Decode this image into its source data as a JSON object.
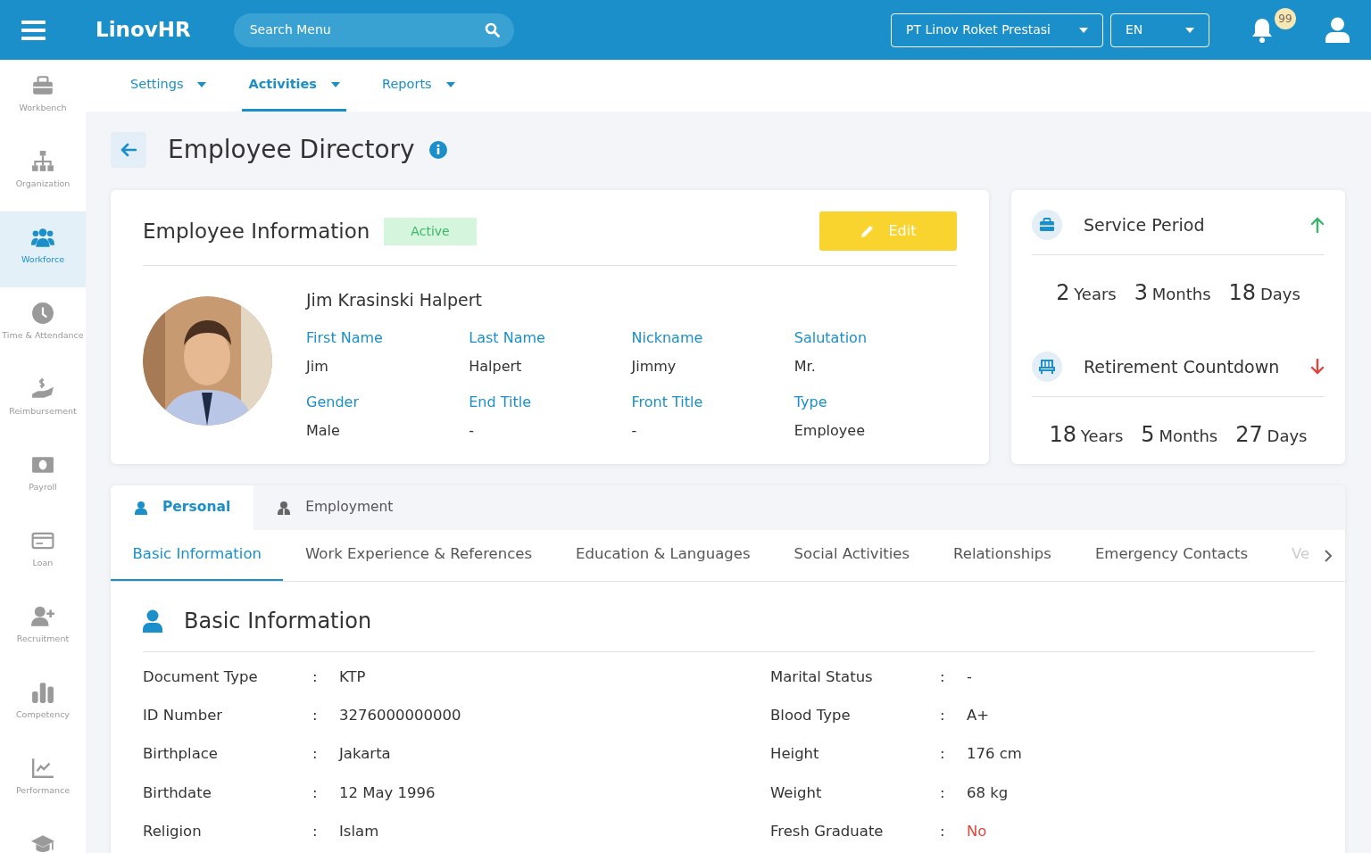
{
  "topbar": {
    "logo": "LinovHR",
    "search": {
      "placeholder": "Search Menu"
    },
    "company": "PT Linov Roket Prestasi",
    "language": "EN",
    "notification_count": "99"
  },
  "sidebar": {
    "items": [
      {
        "label": "Workbench",
        "selected": false
      },
      {
        "label": "Organization",
        "selected": false
      },
      {
        "label": "Workforce",
        "selected": true
      },
      {
        "label": "Time & Attendance",
        "selected": false
      },
      {
        "label": "Reimbursement",
        "selected": false
      },
      {
        "label": "Payroll",
        "selected": false
      },
      {
        "label": "Loan",
        "selected": false
      },
      {
        "label": "Recruitment",
        "selected": false
      },
      {
        "label": "Competency",
        "selected": false
      },
      {
        "label": "Performance",
        "selected": false
      },
      {
        "selected": false
      }
    ]
  },
  "menu": [
    {
      "label": "Settings",
      "selected": false
    },
    {
      "label": "Activities",
      "selected": true
    },
    {
      "label": "Reports",
      "selected": false
    }
  ],
  "page": {
    "title": "Employee Directory"
  },
  "employee_card": {
    "title": "Employee Information",
    "status": "Active",
    "edit_button": "Edit",
    "full_name": "Jim Krasinski Halpert",
    "fields": [
      {
        "label": "First Name",
        "value": "Jim"
      },
      {
        "label": "Last Name",
        "value": "Halpert"
      },
      {
        "label": "Nickname",
        "value": "Jimmy"
      },
      {
        "label": "Salutation",
        "value": "Mr."
      },
      {
        "label": "Gender",
        "value": "Male"
      },
      {
        "label": "End Title",
        "value": "-"
      },
      {
        "label": "Front Title",
        "value": "-"
      },
      {
        "label": "Type",
        "value": "Employee"
      }
    ]
  },
  "periods": [
    {
      "title": "Service Period",
      "rising": true,
      "parts": [
        {
          "number": "2",
          "unit": "Years"
        },
        {
          "number": "3",
          "unit": "Months"
        },
        {
          "number": "18",
          "unit": "Days"
        }
      ]
    },
    {
      "title": "Retirement Countdown",
      "rising": false,
      "parts": [
        {
          "number": "18",
          "unit": "Years"
        },
        {
          "number": "5",
          "unit": "Months"
        },
        {
          "number": "27",
          "unit": "Days"
        }
      ]
    }
  ],
  "main_tabs": [
    {
      "label": "Personal",
      "selected": true
    },
    {
      "label": "Employment",
      "selected": false
    }
  ],
  "sub_tabs": [
    {
      "label": "Basic Information",
      "selected": true
    },
    {
      "label": "Work Experience & References",
      "selected": false
    },
    {
      "label": "Education & Languages",
      "selected": false
    },
    {
      "label": "Social Activities",
      "selected": false
    },
    {
      "label": "Relationships",
      "selected": false
    },
    {
      "label": "Emergency Contacts",
      "selected": false
    },
    {
      "label": "Ve",
      "selected": false
    }
  ],
  "basic_information": {
    "title": "Basic Information",
    "separator": ":",
    "left": [
      {
        "label": "Document Type",
        "value": "KTP"
      },
      {
        "label": "ID Number",
        "value": "3276000000000"
      },
      {
        "label": "Birthplace",
        "value": "Jakarta"
      },
      {
        "label": "Birthdate",
        "value": "12 May 1996"
      },
      {
        "label": "Religion",
        "value": "Islam"
      }
    ],
    "right": [
      {
        "label": "Marital Status",
        "value": "-"
      },
      {
        "label": "Blood Type",
        "value": "A+"
      },
      {
        "label": "Height",
        "value": "176 cm"
      },
      {
        "label": "Weight",
        "value": "68 kg"
      },
      {
        "label": "Fresh Graduate",
        "value": "No",
        "color": "#e0443c"
      }
    ]
  }
}
